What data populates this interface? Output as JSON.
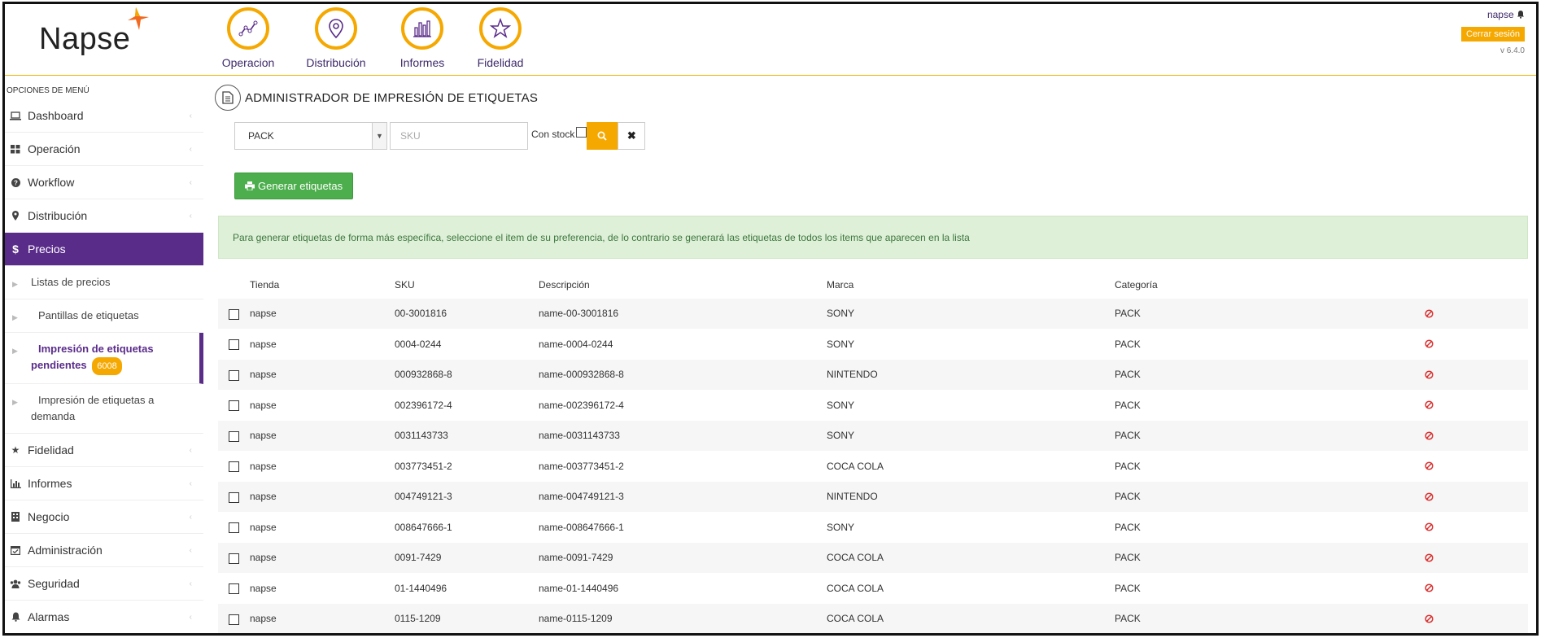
{
  "brand": {
    "logo_text": "Napse",
    "accent": "#f5a800",
    "primary": "#5a2c8a"
  },
  "topnav": [
    {
      "label": "Operacion",
      "icon": "line-chart-icon"
    },
    {
      "label": "Distribución",
      "icon": "map-pin-icon"
    },
    {
      "label": "Informes",
      "icon": "bar-chart-icon"
    },
    {
      "label": "Fidelidad",
      "icon": "star-icon"
    }
  ],
  "user": {
    "name": "napse",
    "logout_label": "Cerrar sesión",
    "version": "v 6.4.0"
  },
  "sidebar": {
    "heading": "OPCIONES DE MENÚ",
    "items": [
      {
        "label": "Dashboard",
        "icon": "laptop-icon"
      },
      {
        "label": "Operación",
        "icon": "grid-icon"
      },
      {
        "label": "Workflow",
        "icon": "question-circle-icon"
      },
      {
        "label": "Distribución",
        "icon": "map-pin-icon"
      },
      {
        "label": "Precios",
        "icon": "dollar-icon"
      },
      {
        "label": "Fidelidad",
        "icon": "star-icon"
      },
      {
        "label": "Informes",
        "icon": "bar-chart-icon"
      },
      {
        "label": "Negocio",
        "icon": "building-icon"
      },
      {
        "label": "Administración",
        "icon": "calendar-check-icon"
      },
      {
        "label": "Seguridad",
        "icon": "users-icon"
      },
      {
        "label": "Alarmas",
        "icon": "bell-icon"
      }
    ],
    "sub_items": [
      {
        "label": "Listas de precios"
      },
      {
        "label": "Pantillas de etiquetas"
      },
      {
        "label_line1": "Impresión de etiquetas",
        "label_line2": "pendientes",
        "badge": "6008"
      },
      {
        "label_line1": "Impresión de etiquetas a",
        "label_line2": "demanda"
      }
    ]
  },
  "page": {
    "title": "ADMINISTRADOR DE IMPRESIÓN DE ETIQUETAS"
  },
  "filters": {
    "category_value": "PACK",
    "sku_placeholder": "SKU",
    "stock_label": "Con stock",
    "generate_label": "Generar etiquetas"
  },
  "alert": {
    "text": "Para generar etiquetas de forma más específica, seleccione el item de su preferencia, de lo contrario se generará las etiquetas de todos los items que aparecen en la lista"
  },
  "table": {
    "columns": [
      "Tienda",
      "SKU",
      "Descripción",
      "Marca",
      "Categoría"
    ],
    "rows": [
      {
        "tienda": "napse",
        "sku": "00-3001816",
        "desc": "name-00-3001816",
        "marca": "SONY",
        "cat": "PACK"
      },
      {
        "tienda": "napse",
        "sku": "0004-0244",
        "desc": "name-0004-0244",
        "marca": "SONY",
        "cat": "PACK"
      },
      {
        "tienda": "napse",
        "sku": "000932868-8",
        "desc": "name-000932868-8",
        "marca": "NINTENDO",
        "cat": "PACK"
      },
      {
        "tienda": "napse",
        "sku": "002396172-4",
        "desc": "name-002396172-4",
        "marca": "SONY",
        "cat": "PACK"
      },
      {
        "tienda": "napse",
        "sku": "0031143733",
        "desc": "name-0031143733",
        "marca": "SONY",
        "cat": "PACK"
      },
      {
        "tienda": "napse",
        "sku": "003773451-2",
        "desc": "name-003773451-2",
        "marca": "COCA COLA",
        "cat": "PACK"
      },
      {
        "tienda": "napse",
        "sku": "004749121-3",
        "desc": "name-004749121-3",
        "marca": "NINTENDO",
        "cat": "PACK"
      },
      {
        "tienda": "napse",
        "sku": "008647666-1",
        "desc": "name-008647666-1",
        "marca": "SONY",
        "cat": "PACK"
      },
      {
        "tienda": "napse",
        "sku": "0091-7429",
        "desc": "name-0091-7429",
        "marca": "COCA COLA",
        "cat": "PACK"
      },
      {
        "tienda": "napse",
        "sku": "01-1440496",
        "desc": "name-01-1440496",
        "marca": "COCA COLA",
        "cat": "PACK"
      },
      {
        "tienda": "napse",
        "sku": "0115-1209",
        "desc": "name-0115-1209",
        "marca": "COCA COLA",
        "cat": "PACK"
      }
    ]
  }
}
